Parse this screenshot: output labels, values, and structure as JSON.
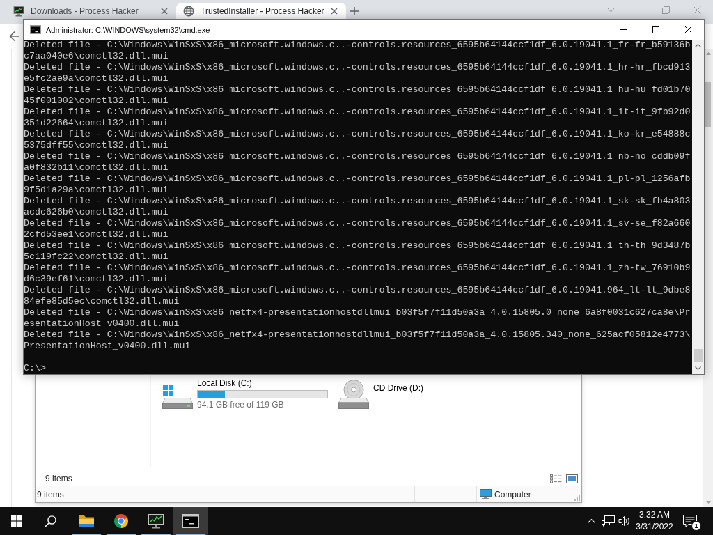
{
  "browser": {
    "tabs": [
      {
        "kind": "app",
        "title": "Downloads - Process Hacker",
        "selected": false
      },
      {
        "kind": "web",
        "title": "TrustedInstaller - Process Hacker",
        "selected": true
      }
    ]
  },
  "console_window": {
    "title": "Administrator: C:\\WINDOWS\\system32\\cmd.exe",
    "lines": [
      "Deleted file - C:\\Windows\\WinSxS\\x86_microsoft.windows.c..-controls.resources_6595b64144ccf1df_6.0.19041.1_fr-fr_b59136b",
      "c7aa040e6\\comctl32.dll.mui",
      "Deleted file - C:\\Windows\\WinSxS\\x86_microsoft.windows.c..-controls.resources_6595b64144ccf1df_6.0.19041.1_hr-hr_fbcd913",
      "e5fc2ae9a\\comctl32.dll.mui",
      "Deleted file - C:\\Windows\\WinSxS\\x86_microsoft.windows.c..-controls.resources_6595b64144ccf1df_6.0.19041.1_hu-hu_fd01b70",
      "45f001002\\comctl32.dll.mui",
      "Deleted file - C:\\Windows\\WinSxS\\x86_microsoft.windows.c..-controls.resources_6595b64144ccf1df_6.0.19041.1_it-it_9fb92d0",
      "351d22664\\comctl32.dll.mui",
      "Deleted file - C:\\Windows\\WinSxS\\x86_microsoft.windows.c..-controls.resources_6595b64144ccf1df_6.0.19041.1_ko-kr_e54888c",
      "5375dff55\\comctl32.dll.mui",
      "Deleted file - C:\\Windows\\WinSxS\\x86_microsoft.windows.c..-controls.resources_6595b64144ccf1df_6.0.19041.1_nb-no_cddb09f",
      "a0f832b11\\comctl32.dll.mui",
      "Deleted file - C:\\Windows\\WinSxS\\x86_microsoft.windows.c..-controls.resources_6595b64144ccf1df_6.0.19041.1_pl-pl_1256afb",
      "9f5d1a29a\\comctl32.dll.mui",
      "Deleted file - C:\\Windows\\WinSxS\\x86_microsoft.windows.c..-controls.resources_6595b64144ccf1df_6.0.19041.1_sk-sk_fb4a803",
      "acdc626b0\\comctl32.dll.mui",
      "Deleted file - C:\\Windows\\WinSxS\\x86_microsoft.windows.c..-controls.resources_6595b64144ccf1df_6.0.19041.1_sv-se_f82a660",
      "2cfd53ee1\\comctl32.dll.mui",
      "Deleted file - C:\\Windows\\WinSxS\\x86_microsoft.windows.c..-controls.resources_6595b64144ccf1df_6.0.19041.1_th-th_9d3487b",
      "5c119fc22\\comctl32.dll.mui",
      "Deleted file - C:\\Windows\\WinSxS\\x86_microsoft.windows.c..-controls.resources_6595b64144ccf1df_6.0.19041.1_zh-tw_76910b9",
      "d6c39ef61\\comctl32.dll.mui",
      "Deleted file - C:\\Windows\\WinSxS\\x86_microsoft.windows.c..-controls.resources_6595b64144ccf1df_6.0.19041.964_lt-lt_9dbe8",
      "84efe85d5ec\\comctl32.dll.mui",
      "Deleted file - C:\\Windows\\WinSxS\\x86_netfx4-presentationhostdllmui_b03f5f7f11d50a3a_4.0.15805.0_none_6a8f0031c627ca8e\\Pr",
      "esentationHost_v0400.dll.mui",
      "Deleted file - C:\\Windows\\WinSxS\\x86_netfx4-presentationhostdllmui_b03f5f7f11d50a3a_4.0.15805.340_none_625acf05812e4773\\",
      "PresentationHost_v0400.dll.mui"
    ],
    "prompt": "C:\\>"
  },
  "explorer": {
    "drives": [
      {
        "kind": "local",
        "name": "Local Disk (C:)",
        "level": 0.21,
        "free_space": "94.1 GB free of 119 GB"
      },
      {
        "kind": "optical",
        "name": "CD Drive (D:)"
      }
    ],
    "item_count": "9 items",
    "status_bar": {
      "items": "9 items",
      "zone": "Computer"
    }
  },
  "taskbar": {
    "apps": [
      {
        "kind": "explorer",
        "running": true,
        "selected": false
      },
      {
        "kind": "browser",
        "running": true,
        "selected": false
      },
      {
        "kind": "monitor",
        "running": true,
        "selected": false
      },
      {
        "kind": "console",
        "running": true,
        "selected": true
      }
    ],
    "time": "3:32 AM",
    "date": "3/31/2022",
    "notifications": "1"
  }
}
